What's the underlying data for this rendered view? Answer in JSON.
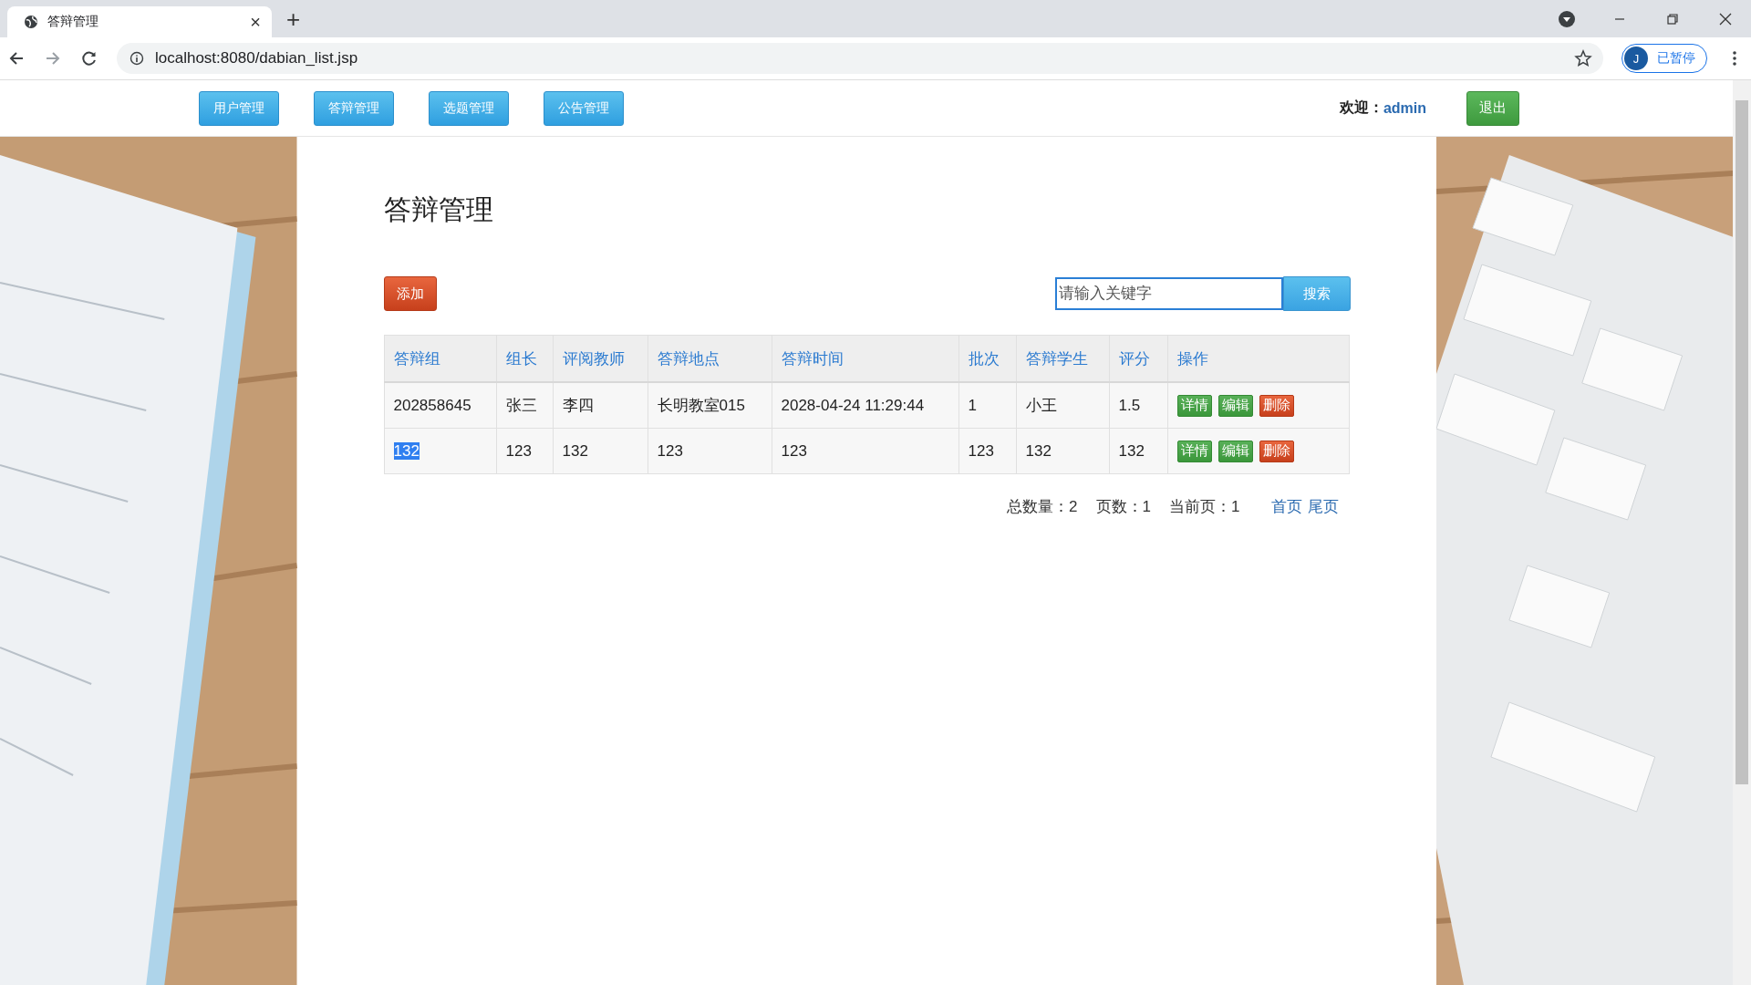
{
  "browser": {
    "tab": {
      "title": "答辩管理",
      "close": "×"
    },
    "new_tab": "+",
    "url": "localhost:8080/dabian_list.jsp",
    "profile": {
      "initial": "J",
      "status": "已暂停"
    }
  },
  "nav": {
    "items": [
      "用户管理",
      "答辩管理",
      "选题管理",
      "公告管理"
    ],
    "welcome_label": "欢迎：",
    "user": "admin",
    "logout": "退出"
  },
  "page": {
    "title": "答辩管理",
    "add_button": "添加",
    "search": {
      "placeholder": "请输入关键字",
      "button": "搜索",
      "focused": true
    },
    "table": {
      "columns": [
        "答辩组",
        "组长",
        "评阅教师",
        "答辩地点",
        "答辩时间",
        "批次",
        "答辩学生",
        "评分",
        "操作"
      ],
      "rows": [
        {
          "cells": [
            "202858645",
            "张三",
            "李四",
            "长明教室015",
            "2028-04-24 11:29:44",
            "1",
            "小王",
            "1.5"
          ],
          "first_cell_selected": false,
          "actions": [
            {
              "label": "详情",
              "kind": "view"
            },
            {
              "label": "编辑",
              "kind": "edit"
            },
            {
              "label": "删除",
              "kind": "delete"
            }
          ]
        },
        {
          "cells": [
            "132",
            "123",
            "132",
            "123",
            "123",
            "123",
            "132",
            "132"
          ],
          "first_cell_selected": true,
          "actions": [
            {
              "label": "详情",
              "kind": "view"
            },
            {
              "label": "编辑",
              "kind": "edit"
            },
            {
              "label": "删除",
              "kind": "delete"
            }
          ]
        }
      ]
    },
    "pagination": {
      "total": "总数量：2",
      "pages": "页数：1",
      "current": "当前页：1",
      "first": "首页",
      "last": "尾页"
    }
  }
}
